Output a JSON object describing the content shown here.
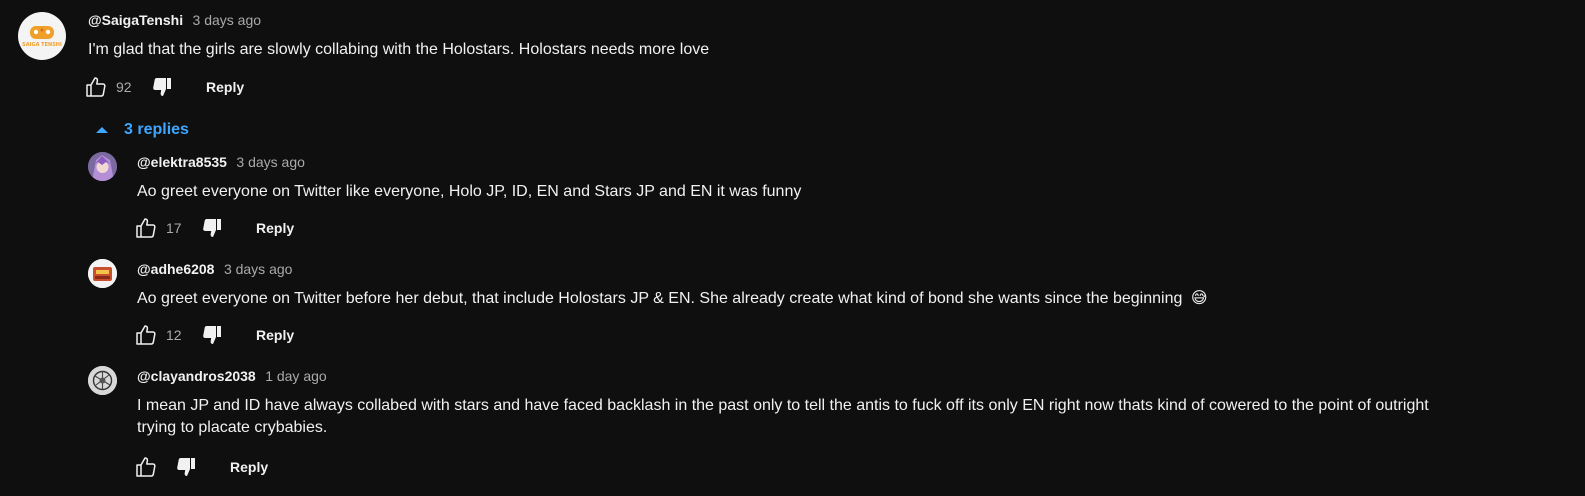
{
  "top_comment": {
    "author": "@SaigaTenshi",
    "time": "3 days ago",
    "text": "I'm glad that the girls are slowly collabing with the Holostars. Holostars needs more love",
    "likes": "92",
    "reply_label": "Reply",
    "avatar_text": "SAIGA TENSHI"
  },
  "replies_toggle": {
    "label": "3 replies"
  },
  "replies": [
    {
      "author": "@elektra8535",
      "time": "3 days ago",
      "text": "Ao greet everyone on Twitter like everyone, Holo JP, ID, EN and Stars JP and EN it was funny",
      "likes": "17",
      "reply_label": "Reply"
    },
    {
      "author": "@adhe6208",
      "time": "3 days ago",
      "text": "Ao greet everyone on Twitter before her debut, that include Holostars JP & EN. She already create what kind of bond she wants since the beginning",
      "emoji": "😅",
      "likes": "12",
      "reply_label": "Reply"
    },
    {
      "author": "@clayandros2038",
      "time": "1 day ago",
      "text_line1": "I mean JP and ID have always collabed with stars and have faced backlash in the past only to tell the antis to fuck off its only EN right now thats kind of cowered to the point of outright",
      "text_line2": "trying to placate crybabies.",
      "likes": "",
      "reply_label": "Reply"
    }
  ],
  "icons": {
    "like": "thumbs-up-icon",
    "dislike": "thumbs-down-icon",
    "collapse": "caret-up-icon"
  },
  "colors": {
    "background": "#0f0f0f",
    "text": "#f1f1f1",
    "muted": "#aaaaaa",
    "link": "#3ea6ff"
  }
}
